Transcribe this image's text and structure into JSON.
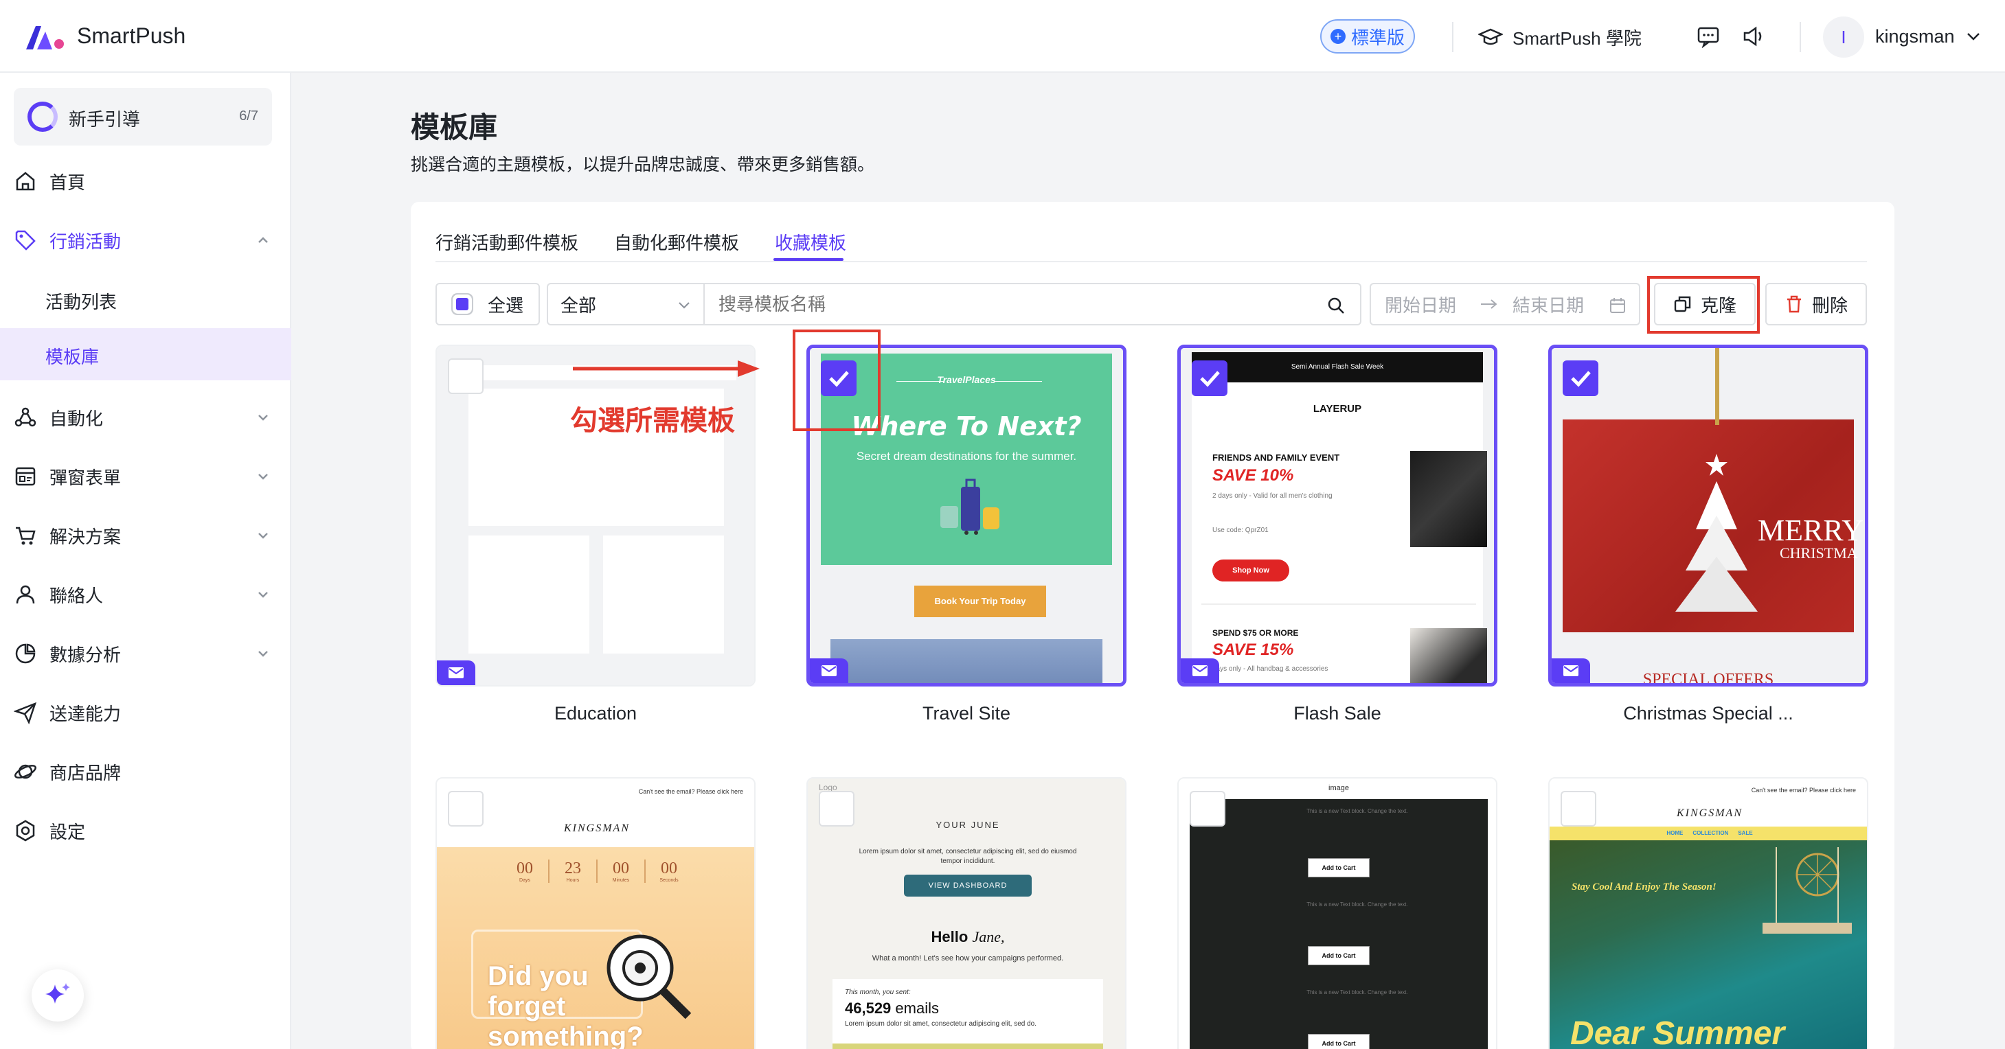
{
  "app": {
    "name": "SmartPush",
    "plan_badge": "標準版",
    "academy": "SmartPush 學院",
    "avatar_initial": "I",
    "username": "kingsman"
  },
  "sidebar": {
    "guide": {
      "label": "新手引導",
      "progress": "6/7"
    },
    "items": [
      {
        "label": "首頁",
        "icon": "home-icon"
      },
      {
        "label": "行銷活動",
        "icon": "tag-icon",
        "expanded": true
      },
      {
        "label": "自動化",
        "icon": "automation-icon"
      },
      {
        "label": "彈窗表單",
        "icon": "form-icon"
      },
      {
        "label": "解決方案",
        "icon": "cart-icon"
      },
      {
        "label": "聯絡人",
        "icon": "user-icon"
      },
      {
        "label": "數據分析",
        "icon": "pie-icon"
      },
      {
        "label": "送達能力",
        "icon": "send-icon"
      },
      {
        "label": "商店品牌",
        "icon": "planet-icon"
      },
      {
        "label": "設定",
        "icon": "settings-icon"
      }
    ],
    "sub_items": [
      {
        "label": "活動列表"
      },
      {
        "label": "模板庫",
        "selected": true
      }
    ]
  },
  "page": {
    "title": "模板庫",
    "description": "挑選合適的主題模板，以提升品牌忠誠度、帶來更多銷售額。"
  },
  "tabs": [
    {
      "label": "行銷活動郵件模板"
    },
    {
      "label": "自動化郵件模板"
    },
    {
      "label": "收藏模板",
      "active": true
    }
  ],
  "toolbar": {
    "select_all": "全選",
    "filter": "全部",
    "search_placeholder": "搜尋模板名稱",
    "start_date": "開始日期",
    "end_date": "結束日期",
    "clone": "克隆",
    "delete": "刪除"
  },
  "annotation": {
    "text": "勾選所需模板"
  },
  "cards": [
    {
      "name": "Education",
      "selected": false
    },
    {
      "name": "Travel Site",
      "selected": true,
      "preview": {
        "brand": "TravelPlaces",
        "headline": "Where To Next?",
        "sub": "Secret dream destinations for the summer.",
        "cta": "Book Your Trip Today"
      }
    },
    {
      "name": "Flash Sale",
      "selected": true,
      "preview": {
        "top": "Semi Annual Flash Sale Week",
        "brand": "LAYERUP",
        "event1": "FRIENDS AND FAMILY EVENT",
        "save1": "SAVE 10%",
        "note1": "2 days only - Valid for all men's clothing",
        "code": "Use code: QprZ01",
        "cta": "Shop Now",
        "event2": "SPEND $75 OR MORE",
        "save2": "SAVE 15%",
        "note2": "days only - All handbag & accessories"
      }
    },
    {
      "name": "Christmas Special ...",
      "selected": true,
      "preview": {
        "line1": "MERRY",
        "line2": "CHRISTMA",
        "bottom": "SPECIAL OFFERS"
      }
    }
  ],
  "cards_row2": [
    {
      "top": "Can't see the email? Please click here",
      "brand": "KINGSMAN",
      "timer": [
        "00",
        "23",
        "00",
        "00"
      ],
      "timer_units": [
        "Days",
        "Hours",
        "Minutes",
        "Seconds"
      ],
      "headline": "Did you forget something?"
    },
    {
      "logo": "Logo",
      "title": "YOUR JUNE",
      "body": "Lorem ipsum dolor sit amet, consectetur adipiscing elit, sed do eiusmod tempor incididunt.",
      "cta": "VIEW DASHBOARD",
      "hello": "Hello",
      "name": "Jane,",
      "line": "What a month! Let's see how your campaigns performed.",
      "sent_label": "This month, you sent:",
      "sent_value": "46,529",
      "sent_unit": "emails",
      "lorem": "Lorem ipsum dolor sit amet, consectetur adipiscing elit, sed do."
    },
    {
      "image": "image",
      "text": "This is a new Text block. Change the text.",
      "cta": "Add to Cart"
    },
    {
      "top": "Can't see the email? Please click here",
      "brand": "KINGSMAN",
      "nav": [
        "HOME",
        "COLLECTION",
        "SALE"
      ],
      "tagline": "Stay Cool And Enjoy The Season!",
      "headline": "Dear Summer"
    }
  ],
  "colors": {
    "accent": "#5b3df5",
    "annotation": "#e23a2e",
    "travel_green": "#5cc99a",
    "sale_red": "#e02424",
    "xmas_red": "#b72a24"
  }
}
